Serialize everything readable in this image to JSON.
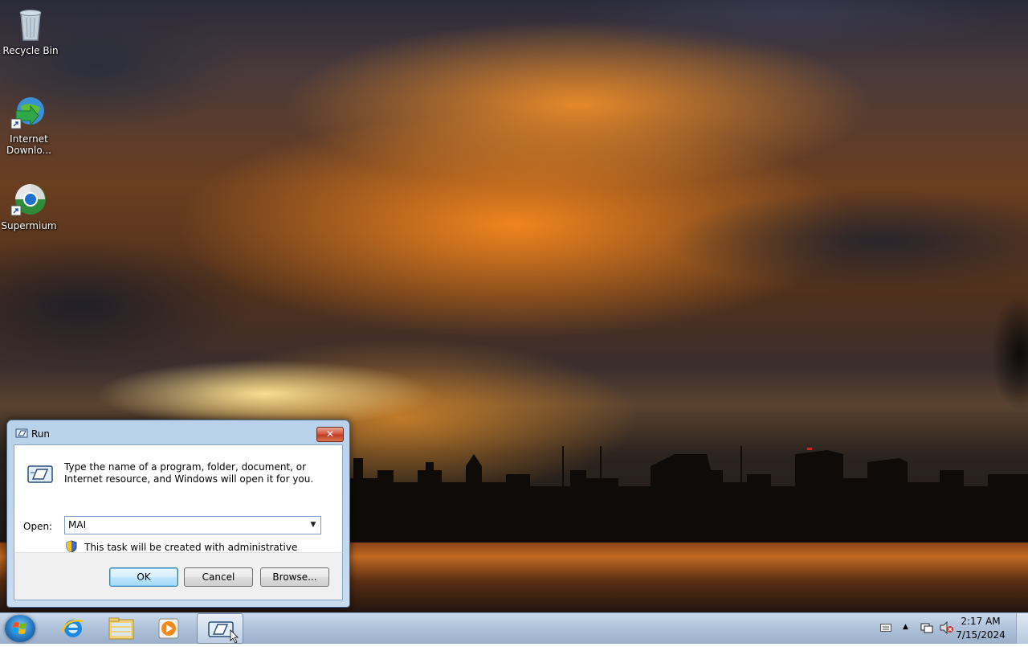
{
  "desktop": {
    "icons": [
      {
        "label": "Recycle Bin",
        "icon": "recycle-bin-icon"
      },
      {
        "label": "Internet Downlo...",
        "icon": "internet-download-manager-icon"
      },
      {
        "label": "Supermium",
        "icon": "supermium-browser-icon"
      }
    ]
  },
  "run_dialog": {
    "title": "Run",
    "close_label": "✕",
    "description": "Type the name of a program, folder, document, or Internet resource, and Windows will open it for you.",
    "open_label": "Open:",
    "open_value": "MAI",
    "admin_note": "This task will be created with administrative privileges.",
    "buttons": {
      "ok": "OK",
      "cancel": "Cancel",
      "browse": "Browse..."
    }
  },
  "taskbar": {
    "items": [
      {
        "name": "start-button",
        "icon": "windows-orb-icon"
      },
      {
        "name": "internet-explorer",
        "icon": "internet-explorer-icon"
      },
      {
        "name": "windows-explorer",
        "icon": "folder-icon"
      },
      {
        "name": "media-player",
        "icon": "media-player-icon"
      },
      {
        "name": "run-dialog",
        "icon": "run-icon",
        "active": true
      }
    ],
    "tray": {
      "time": "2:17 AM",
      "date": "7/15/2024",
      "icons": [
        "keyboard-icon",
        "show-hidden-icons-chevron",
        "action-center-flag-icon",
        "volume-muted-icon"
      ]
    }
  },
  "colors": {
    "dialog_frame": "#b9d1ea",
    "close_button": "#c23b26",
    "default_button_border": "#3c7fb1"
  }
}
